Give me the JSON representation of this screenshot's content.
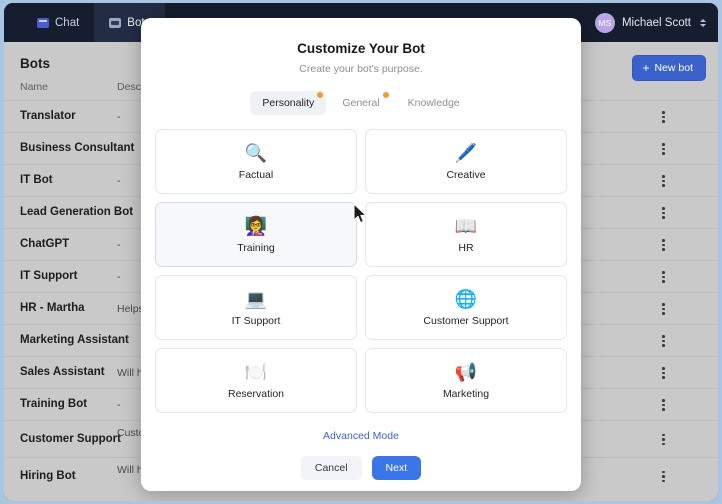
{
  "topbar": {
    "tabs": [
      {
        "label": "Chat",
        "icon": "chat-icon",
        "active": false
      },
      {
        "label": "Bots",
        "icon": "bots-icon",
        "active": true
      }
    ],
    "user": {
      "initials": "MS",
      "name": "Michael Scott"
    }
  },
  "botlist": {
    "title": "Bots",
    "new_bot_label": "New bot",
    "new_bot_plus": "+",
    "columns": {
      "name": "Name",
      "description": "Desc"
    },
    "rows": [
      {
        "name": "Translator",
        "description": "-"
      },
      {
        "name": "Business Consultant",
        "description": "-"
      },
      {
        "name": "IT Bot",
        "description": "-"
      },
      {
        "name": "Lead Generation Bot",
        "description": "-"
      },
      {
        "name": "ChatGPT",
        "description": "-"
      },
      {
        "name": "IT Support",
        "description": "-"
      },
      {
        "name": "HR - Martha",
        "description": "Helps"
      },
      {
        "name": "Marketing Assistant",
        "description": "-"
      },
      {
        "name": "Sales Assistant",
        "description": "Will h"
      },
      {
        "name": "Training Bot",
        "description": "-"
      },
      {
        "name": "Customer Support",
        "description": "Custo websi"
      },
      {
        "name": "Hiring Bot",
        "description": "Will h Ward"
      }
    ]
  },
  "modal": {
    "title": "Customize Your Bot",
    "subtitle": "Create your bot's purpose.",
    "tabs": [
      {
        "label": "Personality",
        "active": true,
        "badge": true
      },
      {
        "label": "General",
        "active": false,
        "badge": true
      },
      {
        "label": "Knowledge",
        "active": false,
        "badge": false
      }
    ],
    "options": [
      {
        "label": "Factual",
        "icon": "magnifying-glass-icon",
        "glyph": "🔍",
        "hovered": false
      },
      {
        "label": "Creative",
        "icon": "pen-icon",
        "glyph": "🖊️",
        "hovered": false
      },
      {
        "label": "Training",
        "icon": "teacher-board-icon",
        "glyph": "👩‍🏫",
        "hovered": true
      },
      {
        "label": "HR",
        "icon": "open-book-icon",
        "glyph": "📖",
        "hovered": false
      },
      {
        "label": "IT Support",
        "icon": "laptop-icon",
        "glyph": "💻",
        "hovered": false
      },
      {
        "label": "Customer Support",
        "icon": "globe-icon",
        "glyph": "🌐",
        "hovered": false
      },
      {
        "label": "Reservation",
        "icon": "plate-cutlery-icon",
        "glyph": "🍽️",
        "hovered": false
      },
      {
        "label": "Marketing",
        "icon": "megaphone-icon",
        "glyph": "📢",
        "hovered": false
      }
    ],
    "advanced_mode_label": "Advanced Mode",
    "cancel_label": "Cancel",
    "next_label": "Next"
  },
  "colors": {
    "topbar_bg": "#161d2e",
    "accent_blue": "#3b76e8",
    "new_bot_blue": "#3b62cc",
    "badge_orange": "#f59b2c",
    "page_bg": "#c9c9c9",
    "window_border": "#a8c6e2"
  }
}
